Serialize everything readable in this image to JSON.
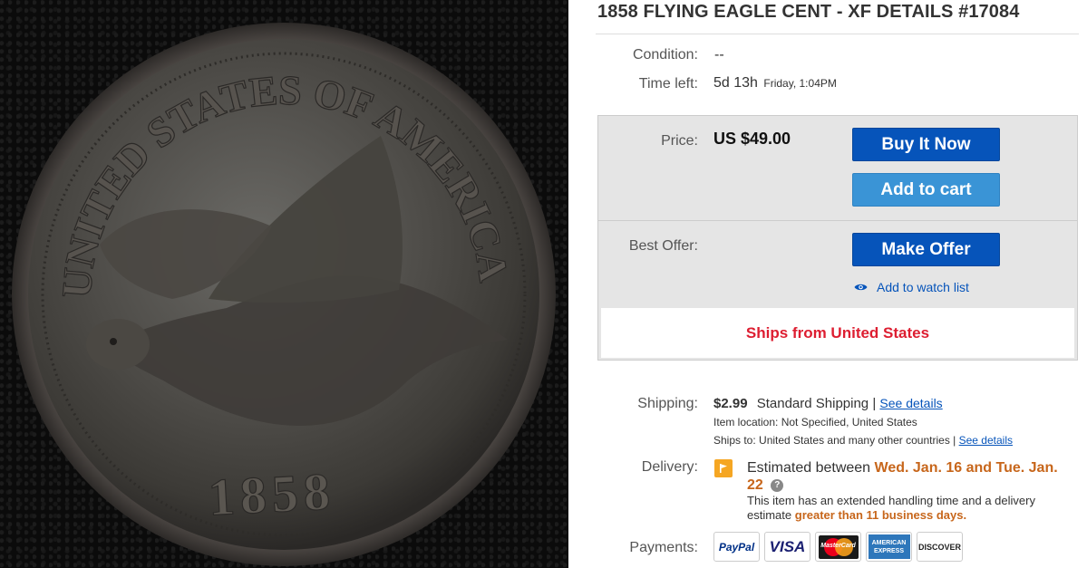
{
  "photo": {
    "legend_top": "UNITED STATES OF AMERICA",
    "year": "1858"
  },
  "listing": {
    "title": "1858 FLYING EAGLE CENT - XF DETAILS #17084",
    "condition_label": "Condition:",
    "condition_value": "--",
    "time_left_label": "Time left:",
    "time_left_value": "5d 13h",
    "time_left_end": "Friday, 1:04PM"
  },
  "purchase": {
    "price_label": "Price:",
    "price_value": "US $49.00",
    "buy_now_label": "Buy It Now",
    "add_to_cart_label": "Add to cart",
    "best_offer_label": "Best Offer:",
    "make_offer_label": "Make Offer",
    "watch_label": "Add to watch list",
    "ships_from": "Ships from United States"
  },
  "shipping": {
    "label": "Shipping:",
    "cost": "$2.99",
    "method": "Standard Shipping",
    "separator": "|",
    "see_details": "See details",
    "item_location": "Item location:  Not Specified, United States",
    "ships_to": "Ships to:  United States and many other countries",
    "ships_to_see_details": "See details"
  },
  "delivery": {
    "label": "Delivery:",
    "estimated_prefix": "Estimated between",
    "date_range_line1": "Wed. Jan. 16 and Tue. Jan.",
    "date_range_line2": "22",
    "help_glyph": "?",
    "note_line1": "This item has an extended handling time and a delivery",
    "note_line2_prefix": "estimate",
    "note_highlight": "greater than 11 business days."
  },
  "payments": {
    "label": "Payments:",
    "methods": [
      {
        "name": "PayPal",
        "color": "#003087"
      },
      {
        "name": "VISA",
        "color": "#1a1f71"
      },
      {
        "name": "MasterCard",
        "color": "#eb001b"
      },
      {
        "name": "AMERICAN EXPRESS",
        "color": "#2e77bb"
      },
      {
        "name": "DISCOVER",
        "color": "#f58220"
      }
    ]
  },
  "colors": {
    "primary_button": "#0654ba",
    "secondary_button": "#3a94d6",
    "ships_from_text": "#dd1e31",
    "delivery_highlight": "#c7661b"
  }
}
